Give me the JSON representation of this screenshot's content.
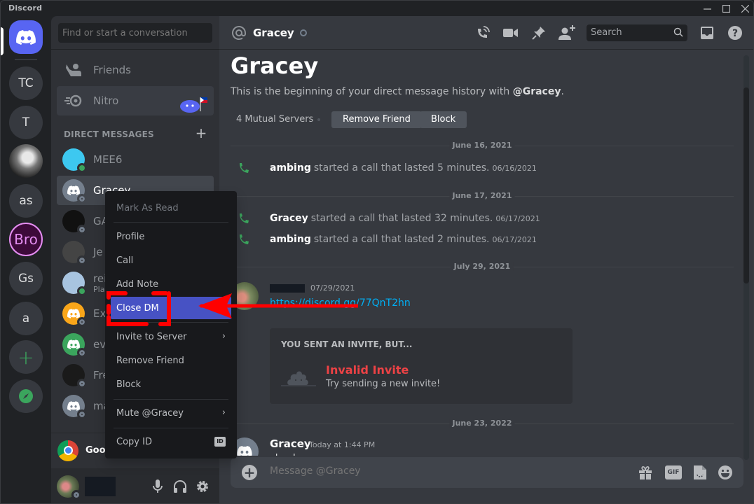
{
  "window": {
    "title": "Discord",
    "controls": [
      "minimize",
      "maximize",
      "close"
    ]
  },
  "server_rail": {
    "home_icon": "discord-logo-icon",
    "servers": [
      {
        "label": "TC"
      },
      {
        "label": "T"
      },
      {
        "label": "",
        "icon": "photo-avatar"
      },
      {
        "label": "as"
      },
      {
        "label": "Bro"
      },
      {
        "label": "Gs"
      },
      {
        "label": "a"
      }
    ],
    "add_server": "+",
    "explore_icon": "compass-icon"
  },
  "dm_sidebar": {
    "search_placeholder": "Find or start a conversation",
    "nav": [
      {
        "label": "Friends",
        "icon": "friends-icon"
      },
      {
        "label": "Nitro",
        "icon": "nitro-icon"
      }
    ],
    "section_header": "DIRECT MESSAGES",
    "add_dm": "+",
    "dms": [
      {
        "name": "MEE6",
        "status": "online",
        "avatar_color": "#3dc8f0"
      },
      {
        "name": "Gracey",
        "status": "offline",
        "avatar_color": "#747f8d",
        "selected": true
      },
      {
        "name": "GA",
        "status": "offline",
        "avatar_color": "#111111"
      },
      {
        "name": "Je",
        "status": "offline",
        "avatar_color": "#444444"
      },
      {
        "name": "rei",
        "sub": "Pla",
        "status": "online",
        "avatar_color": "#a8c4e0"
      },
      {
        "name": "Ex",
        "status": "offline",
        "avatar_color": "#faa61a"
      },
      {
        "name": "ev",
        "status": "offline",
        "avatar_color": "#3ba55d"
      },
      {
        "name": "Fre",
        "status": "offline",
        "avatar_color": "#1a1a1a"
      },
      {
        "name": "ma",
        "status": "offline",
        "avatar_color": "#747f8d"
      }
    ],
    "activity": {
      "name": "Goog",
      "icon": "chrome-icon"
    },
    "user_panel": {
      "status": "offline",
      "controls": [
        "microphone-icon",
        "headphones-icon",
        "settings-icon"
      ]
    }
  },
  "chat": {
    "header": {
      "name": "Gracey",
      "search_placeholder": "Search",
      "buttons": [
        "start-voice-call",
        "start-video-call",
        "pinned-messages",
        "add-friends-to-dm",
        "inbox",
        "help"
      ]
    },
    "intro": {
      "title": "Gracey",
      "subtitle_prefix": "This is the beginning of your direct message history with ",
      "subtitle_mention": "@Gracey",
      "subtitle_suffix": ".",
      "mutual_servers": "4 Mutual Servers",
      "remove_friend": "Remove Friend",
      "block": "Block"
    },
    "dividers": [
      "June 16, 2021",
      "June 17, 2021",
      "July 29, 2021",
      "June 23, 2022"
    ],
    "calls": [
      {
        "user": "ambing",
        "text": "started a call that lasted 5 minutes.",
        "timestamp": "06/16/2021"
      },
      {
        "user": "Gracey",
        "text": "started a call that lasted 32 minutes.",
        "timestamp": "06/17/2021"
      },
      {
        "user": "ambing",
        "text": "started a call that lasted 2 minutes.",
        "timestamp": "06/17/2021"
      }
    ],
    "invite_message": {
      "timestamp": "07/29/2021",
      "link": "https://discord.gg/77QnT2hn",
      "card_header": "YOU SENT AN INVITE, BUT...",
      "card_title": "Invalid Invite",
      "card_subtitle": "Try sending a new invite!"
    },
    "last_message": {
      "user": "Gracey",
      "timestamp": "Today at 1:44 PM",
      "text": "check"
    },
    "composer_placeholder": "Message @Gracey",
    "composer_buttons": [
      "gift-icon",
      "GIF",
      "sticker-icon",
      "emoji-icon"
    ]
  },
  "context_menu": {
    "items": [
      {
        "label": "Mark As Read",
        "disabled": true
      },
      {
        "label": "Profile"
      },
      {
        "label": "Call"
      },
      {
        "label": "Add Note"
      },
      {
        "label": "Close DM",
        "active": true
      },
      {
        "label": "Invite to Server",
        "submenu": true
      },
      {
        "label": "Remove Friend"
      },
      {
        "label": "Block"
      },
      {
        "label": "Mute @Gracey",
        "submenu": true
      },
      {
        "label": "Copy ID",
        "badge": "ID"
      }
    ]
  },
  "annotation": {
    "color": "#ff0000",
    "target": "Close DM"
  },
  "colors": {
    "blurple": "#5865f2",
    "online": "#3ba55d",
    "link": "#00aff4",
    "danger": "#ed4245",
    "menu_active": "#4752c4"
  }
}
